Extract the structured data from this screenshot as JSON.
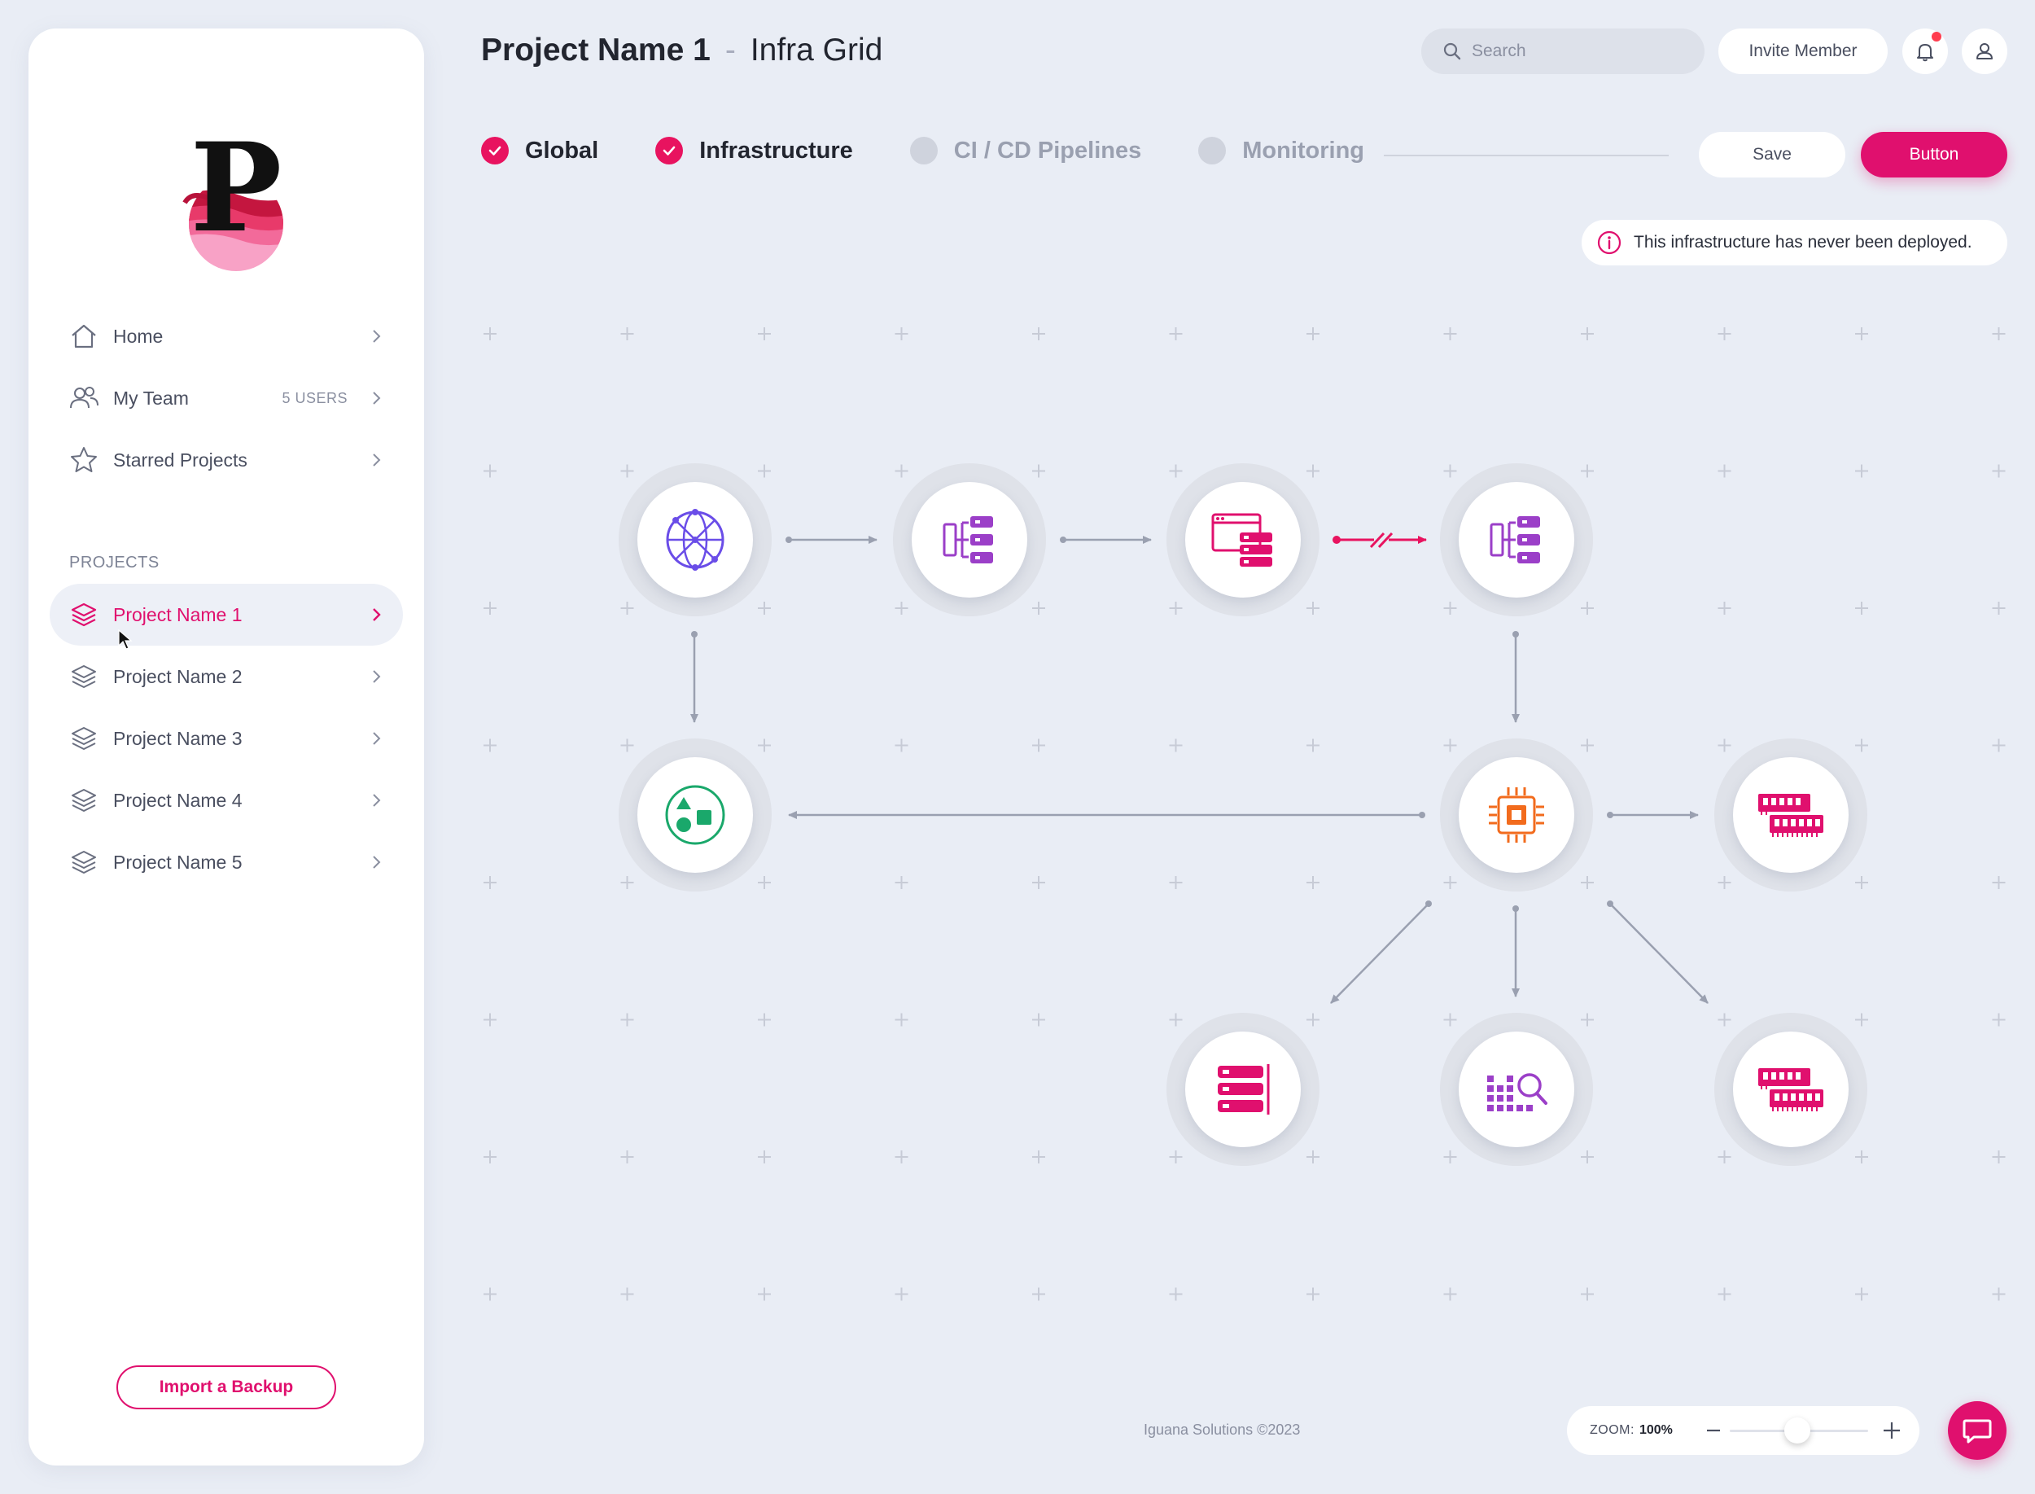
{
  "header": {
    "project": "Project Name 1",
    "separator": "-",
    "page": "Infra Grid",
    "search_placeholder": "Search",
    "invite_label": "Invite Member"
  },
  "sidebar": {
    "nav": [
      {
        "label": "Home",
        "icon": "home-icon"
      },
      {
        "label": "My Team",
        "badge": "5 USERS",
        "icon": "team-icon"
      },
      {
        "label": "Starred Projects",
        "icon": "star-icon"
      }
    ],
    "section_label": "PROJECTS",
    "projects": [
      {
        "label": "Project Name 1",
        "active": true
      },
      {
        "label": "Project Name 2"
      },
      {
        "label": "Project Name 3"
      },
      {
        "label": "Project Name 4"
      },
      {
        "label": "Project Name 5"
      }
    ],
    "import_label": "Import a Backup"
  },
  "steps": [
    {
      "label": "Global",
      "done": true
    },
    {
      "label": "Infrastructure",
      "done": true
    },
    {
      "label": "CI / CD Pipelines",
      "done": false
    },
    {
      "label": "Monitoring",
      "done": false
    }
  ],
  "actions": {
    "save_label": "Save",
    "primary_label": "Button"
  },
  "notice": "This infrastructure has never been deployed.",
  "footer": {
    "copyright": "Iguana Solutions ©2023",
    "zoom_label": "ZOOM:",
    "zoom_value": "100%"
  },
  "colors": {
    "accent": "#e0106e",
    "background": "#e9edf5",
    "purple": "#9b3fc8",
    "orange": "#f26b1d",
    "green": "#1aa86b",
    "blue": "#6a4de8"
  },
  "nodes": [
    {
      "id": "network",
      "icon": "globe-network-icon"
    },
    {
      "id": "orchestrator-1",
      "icon": "hierarchy-servers-icon"
    },
    {
      "id": "web-server",
      "icon": "window-server-icon"
    },
    {
      "id": "orchestrator-2",
      "icon": "hierarchy-servers-icon"
    },
    {
      "id": "shapes",
      "icon": "shapes-icon"
    },
    {
      "id": "cpu",
      "icon": "cpu-chip-icon"
    },
    {
      "id": "ram-1",
      "icon": "ram-memory-icon"
    },
    {
      "id": "storage",
      "icon": "server-rack-icon"
    },
    {
      "id": "analytics",
      "icon": "chart-search-icon"
    },
    {
      "id": "ram-2",
      "icon": "ram-memory-icon"
    }
  ]
}
